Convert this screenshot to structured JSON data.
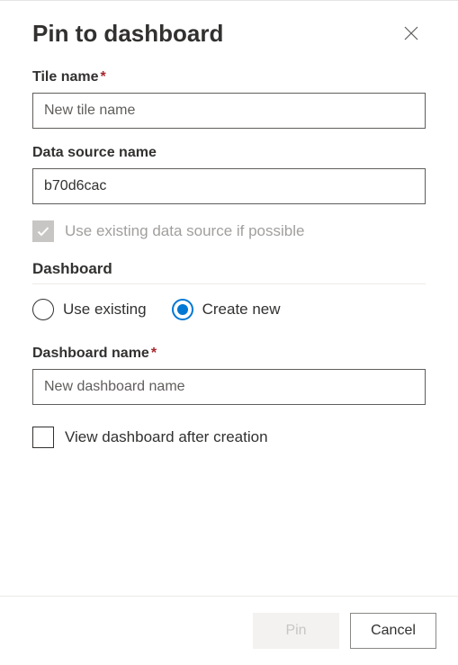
{
  "dialog": {
    "title": "Pin to dashboard"
  },
  "tile_name": {
    "label": "Tile name",
    "placeholder": "New tile name",
    "value": ""
  },
  "data_source": {
    "label": "Data source name",
    "value": "b70d6cac"
  },
  "use_existing_ds": {
    "label": "Use existing data source if possible",
    "checked": true,
    "disabled": true
  },
  "dashboard": {
    "section_label": "Dashboard",
    "options": {
      "existing": "Use existing",
      "create_new": "Create new"
    },
    "selected": "create_new"
  },
  "dashboard_name": {
    "label": "Dashboard name",
    "placeholder": "New dashboard name",
    "value": ""
  },
  "view_after": {
    "label": "View dashboard after creation",
    "checked": false
  },
  "footer": {
    "pin": "Pin",
    "cancel": "Cancel"
  }
}
